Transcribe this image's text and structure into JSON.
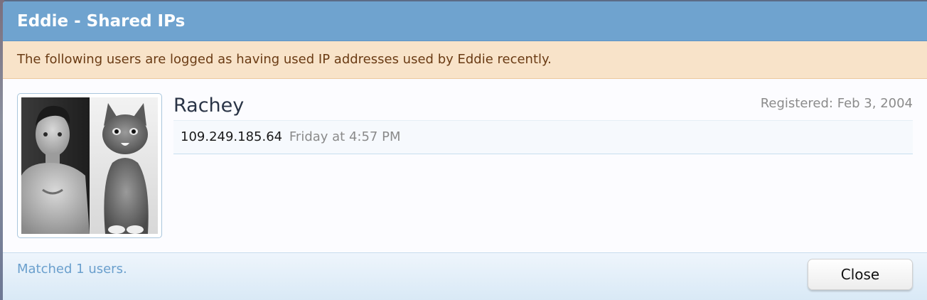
{
  "dialog": {
    "title": "Eddie - Shared IPs",
    "notice": "The following users are logged as having used IP addresses used by Eddie recently."
  },
  "users": [
    {
      "name": "Rachey",
      "registered": "Registered: Feb 3, 2004",
      "avatar_description": "avatar image (man and kitten)",
      "ips": [
        {
          "address": "109.249.185.64",
          "time": "Friday at 4:57 PM"
        }
      ]
    }
  ],
  "footer": {
    "matched_text": "Matched 1 users.",
    "close_label": "Close"
  },
  "colors": {
    "title_bar": "#6fa3cf",
    "notice_bg": "#f8e3c9",
    "notice_text": "#6a3b14",
    "link_blue": "#6a9fcd"
  }
}
